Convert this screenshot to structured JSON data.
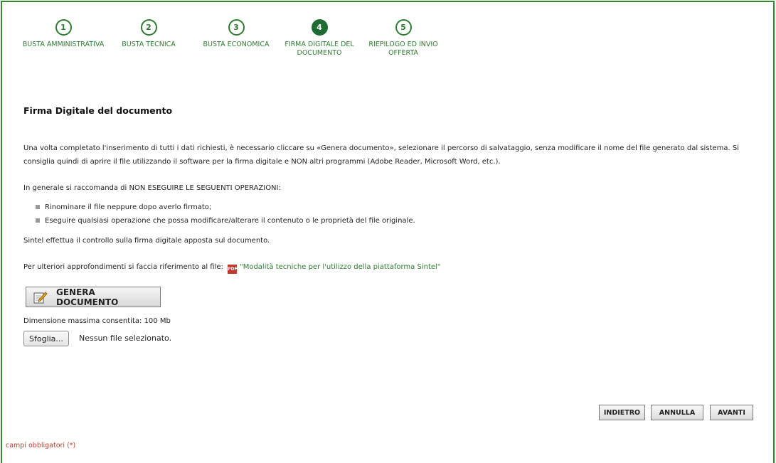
{
  "steps": [
    {
      "number": "1",
      "label": "BUSTA AMMINISTRATIVA"
    },
    {
      "number": "2",
      "label": "BUSTA TECNICA"
    },
    {
      "number": "3",
      "label": "BUSTA ECONOMICA"
    },
    {
      "number": "4",
      "label": "FIRMA DIGITALE DEL DOCUMENTO"
    },
    {
      "number": "5",
      "label": "RIEPILOGO ED INVIO OFFERTA"
    }
  ],
  "active_step": 4,
  "colors": {
    "accent": "#2e7d32",
    "active_step": "#1e6b34",
    "frame": "#2e8b2e",
    "required": "#c0392b"
  },
  "title": "Firma Digitale del documento",
  "intro": "Una volta completato l'inserimento di tutti i dati richiesti, è necessario cliccare su «Genera documento», selezionare il percorso di salvataggio, senza modificare il nome del file generato dal sistema. Si consiglia quindi di aprire il file utilizzando il software per la firma digitale e NON altri programmi (Adobe Reader, Microsoft Word, etc.).",
  "warning_intro": "In generale si raccomanda di NON ESEGUIRE LE SEGUENTI OPERAZIONI:",
  "bullets": [
    "Rinominare il file neppure dopo averlo firmato;",
    "Eseguire qualsiasi operazione che possa modificare/alterare il contenuto o le proprietà del file originale."
  ],
  "check_note": "Sintel effettua il controllo sulla firma digitale apposta sul documento.",
  "reference_text": "Per ulteriori approfondimenti si faccia riferimento al file:",
  "reference_icon": "pdf-icon",
  "pdf_icon_text": "PDF",
  "reference_link": "\"Modalità tecniche per l'utilizzo della piattaforma Sintel\"",
  "genera_button": "GENERA DOCUMENTO",
  "max_size": "Dimensione massima consentita: 100 Mb",
  "browse_button": "Sfoglia...",
  "no_file": "Nessun file selezionato.",
  "nav": {
    "back": "INDIETRO",
    "cancel": "ANNULLA",
    "next": "AVANTI"
  },
  "required_note": "campi obbligatori (*)"
}
